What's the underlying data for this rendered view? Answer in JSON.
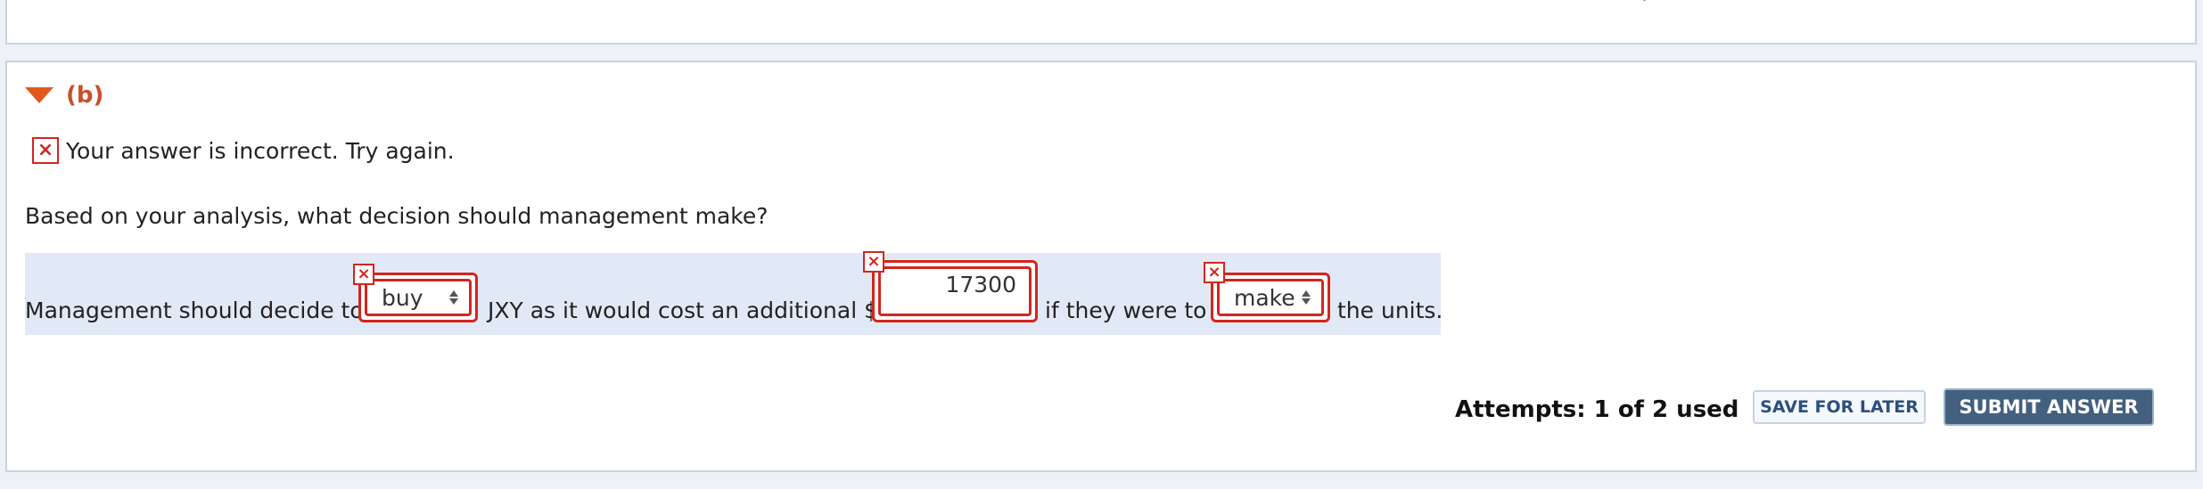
{
  "section": {
    "label": "(b)"
  },
  "feedback": {
    "icon": "x-icon",
    "message": "Your answer is incorrect.  Try again."
  },
  "question": "Based on your analysis, what decision should management make?",
  "answer": {
    "text1": "Management should decide to",
    "select1_value": "buy",
    "text2": "JXY as it would cost an additional $",
    "amount_value": "17300",
    "text3": "if they were to",
    "select2_value": "make",
    "text4": "the units.",
    "error_mark": "×"
  },
  "attempts": "Attempts: 1 of 2 used",
  "buttons": {
    "save": "SAVE FOR LATER",
    "submit": "SUBMIT ANSWER"
  },
  "colors": {
    "error": "#d2261e",
    "accent": "#e05a1e",
    "submit_bg": "#44607f",
    "row_bg": "#e1e9f6"
  }
}
